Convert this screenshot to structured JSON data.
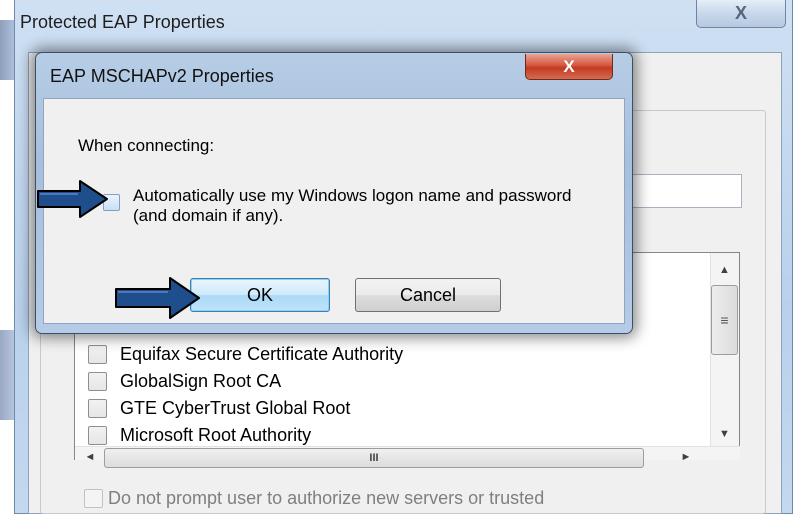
{
  "outer_dialog": {
    "title": "Protected EAP Properties",
    "close_glyph": "X"
  },
  "inner_dialog": {
    "title": "EAP MSCHAPv2 Properties",
    "close_glyph": "X",
    "when_connecting_label": "When connecting:",
    "auto_logon_checkbox": {
      "label": "Automatically use my Windows logon name and password (and domain if any).",
      "checked": false
    },
    "ok_label": "OK",
    "cancel_label": "Cancel"
  },
  "root_ca_list": {
    "items": [
      {
        "label": "Equifax Secure Certificate Authority",
        "checked": false
      },
      {
        "label": "GlobalSign Root CA",
        "checked": false
      },
      {
        "label": "GTE CyberTrust Global Root",
        "checked": false
      },
      {
        "label": "Microsoft Root Authority",
        "checked": false
      }
    ],
    "vscroll_up_glyph": "▲",
    "vscroll_down_glyph": "▼",
    "vscroll_thumb_grip": "≡",
    "hscroll_left_glyph": "◄",
    "hscroll_right_glyph": "►",
    "hscroll_thumb_grip": "III"
  },
  "do_not_prompt_checkbox": {
    "label": "Do not prompt user to authorize new servers or trusted",
    "checked": false,
    "disabled": true
  },
  "annotations": {
    "arrow_color": "#1f4e8c",
    "arrow_icon": "arrow-right-icon"
  },
  "colors": {
    "ok_button_border": "#3c7fb1",
    "close_button_red": "#c23a21"
  }
}
